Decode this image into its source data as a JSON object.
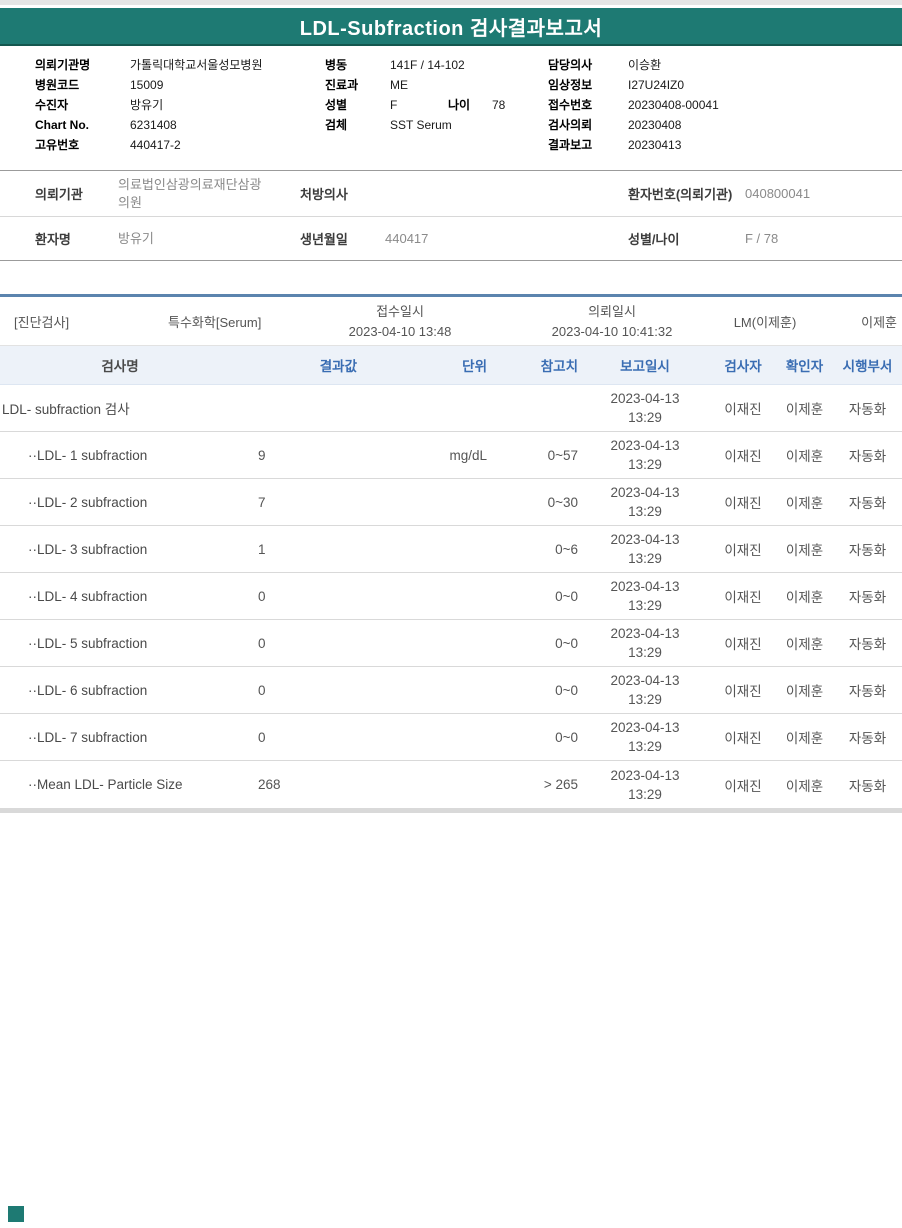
{
  "title": "LDL-Subfraction 검사결과보고서",
  "header_info": {
    "left": [
      {
        "label": "의뢰기관명",
        "value": "가톨릭대학교서울성모병원"
      },
      {
        "label": "병원코드",
        "value": "15009"
      },
      {
        "label": "수진자",
        "value": "방유기"
      },
      {
        "label": "Chart No.",
        "value": "6231408"
      },
      {
        "label": "고유번호",
        "value": "440417-2"
      }
    ],
    "middle": [
      {
        "label": "병동",
        "value": "141F / 14-102"
      },
      {
        "label": "진료과",
        "value": "ME"
      },
      {
        "label": "성별",
        "value": "F",
        "label2": "나이",
        "value2": "78"
      },
      {
        "label": "검체",
        "value": "SST Serum"
      }
    ],
    "right": [
      {
        "label": "담당의사",
        "value": "이승환"
      },
      {
        "label": "임상정보",
        "value": "I27U24IZ0"
      },
      {
        "label": "접수번호",
        "value": "20230408-00041"
      },
      {
        "label": "검사의뢰",
        "value": "20230408"
      },
      {
        "label": "결과보고",
        "value": "20230413"
      }
    ]
  },
  "patient": {
    "row1": {
      "label1": "의뢰기관",
      "value1": "의료법인삼광의료재단삼광의원",
      "label2": "처방의사",
      "value2": "",
      "label3": "환자번호(의뢰기관)",
      "value3": "040800041"
    },
    "row2": {
      "label1": "환자명",
      "value1": "방유기",
      "label2": "생년월일",
      "value2": "440417",
      "label3": "성별/나이",
      "value3": "F / 78"
    }
  },
  "results": {
    "meta": {
      "category": "[진단검사]",
      "panel": "특수화학[Serum]",
      "received_label": "접수일시",
      "received_value": "2023-04-10 13:48",
      "requested_label": "의뢰일시",
      "requested_value": "2023-04-10 10:41:32",
      "lm": "LM(이제훈)",
      "pathologist": "이제훈"
    },
    "columns": [
      "검사명",
      "결과값",
      "단위",
      "참고치",
      "보고일시",
      "검사자",
      "확인자",
      "시행부서"
    ],
    "rows": [
      {
        "name": "LDL- subfraction 검사",
        "result": "",
        "unit": "",
        "ref": "",
        "report_date": "2023-04-13",
        "report_time": "13:29",
        "tester": "이재진",
        "verifier": "이제훈",
        "dept": "자동화"
      },
      {
        "name": "··LDL- 1 subfraction",
        "result": "9",
        "unit": "mg/dL",
        "ref": "0~57",
        "report_date": "2023-04-13",
        "report_time": "13:29",
        "tester": "이재진",
        "verifier": "이제훈",
        "dept": "자동화"
      },
      {
        "name": "··LDL- 2 subfraction",
        "result": "7",
        "unit": "",
        "ref": "0~30",
        "report_date": "2023-04-13",
        "report_time": "13:29",
        "tester": "이재진",
        "verifier": "이제훈",
        "dept": "자동화"
      },
      {
        "name": "··LDL- 3 subfraction",
        "result": "1",
        "unit": "",
        "ref": "0~6",
        "report_date": "2023-04-13",
        "report_time": "13:29",
        "tester": "이재진",
        "verifier": "이제훈",
        "dept": "자동화"
      },
      {
        "name": "··LDL- 4 subfraction",
        "result": "0",
        "unit": "",
        "ref": "0~0",
        "report_date": "2023-04-13",
        "report_time": "13:29",
        "tester": "이재진",
        "verifier": "이제훈",
        "dept": "자동화"
      },
      {
        "name": "··LDL- 5 subfraction",
        "result": "0",
        "unit": "",
        "ref": "0~0",
        "report_date": "2023-04-13",
        "report_time": "13:29",
        "tester": "이재진",
        "verifier": "이제훈",
        "dept": "자동화"
      },
      {
        "name": "··LDL- 6 subfraction",
        "result": "0",
        "unit": "",
        "ref": "0~0",
        "report_date": "2023-04-13",
        "report_time": "13:29",
        "tester": "이재진",
        "verifier": "이제훈",
        "dept": "자동화"
      },
      {
        "name": "··LDL- 7 subfraction",
        "result": "0",
        "unit": "",
        "ref": "0~0",
        "report_date": "2023-04-13",
        "report_time": "13:29",
        "tester": "이재진",
        "verifier": "이제훈",
        "dept": "자동화"
      },
      {
        "name": "··Mean LDL- Particle Size",
        "result": "268",
        "unit": "",
        "ref": "> 265",
        "report_date": "2023-04-13",
        "report_time": "13:29",
        "tester": "이재진",
        "verifier": "이제훈",
        "dept": "자동화"
      }
    ]
  },
  "colors": {
    "teal": "#1e7a73",
    "table_header_bg": "#edf2f9",
    "table_header_text": "#3a6db3",
    "blue_rule": "#5b84ae"
  }
}
